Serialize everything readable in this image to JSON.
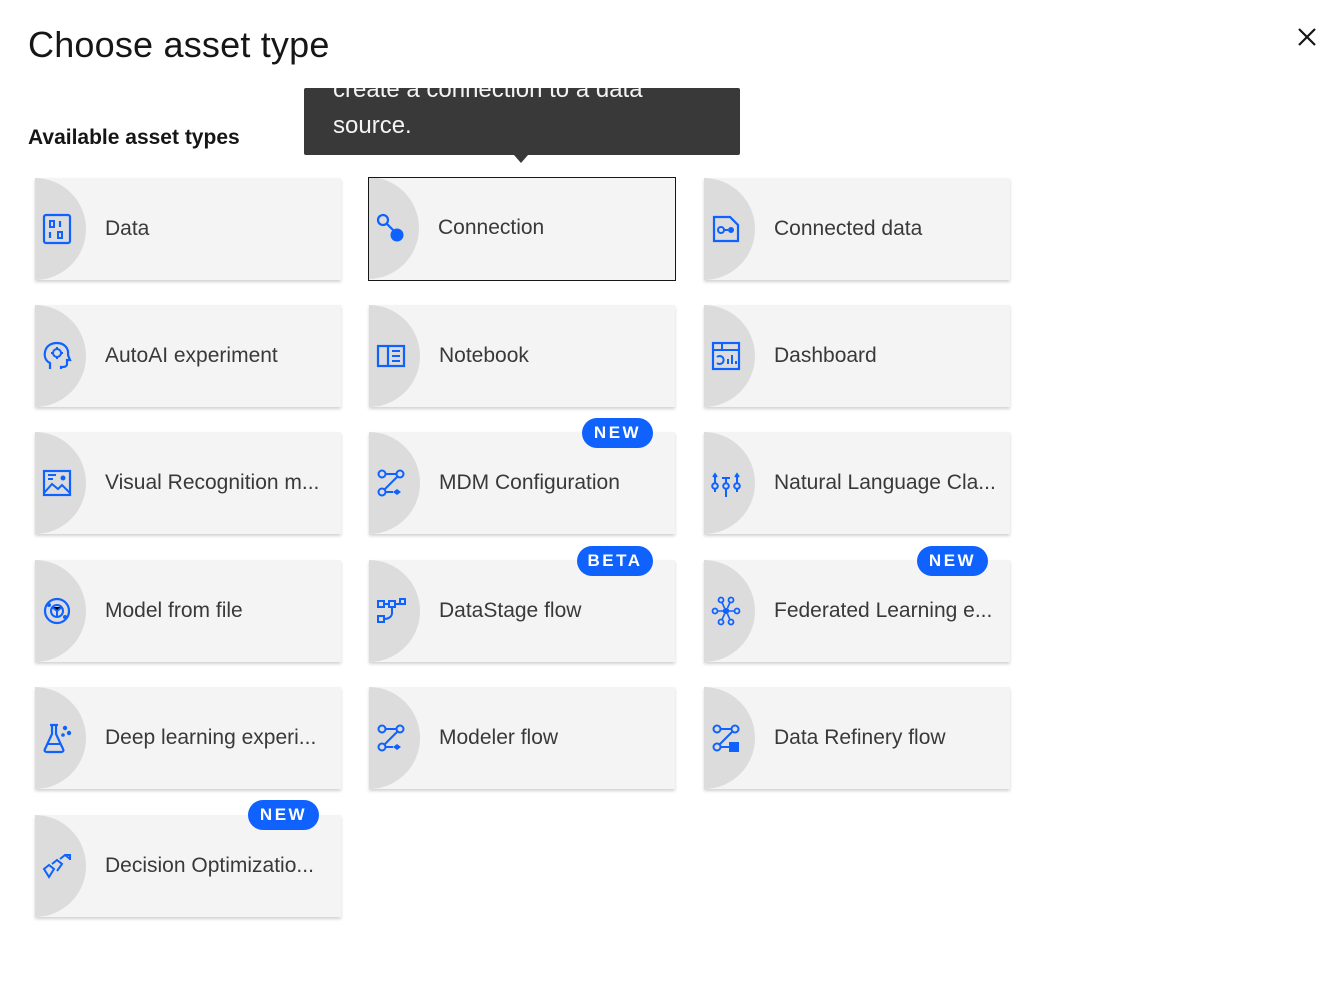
{
  "dialog": {
    "title": "Choose asset type",
    "close_icon": "close-icon"
  },
  "section": {
    "label": "Available asset types"
  },
  "tooltip": {
    "text": "create a connection to a data source."
  },
  "colors": {
    "accent": "#0f62fe",
    "tile_bg": "#f4f4f4",
    "tile_half_circle": "#dcdcdc",
    "tooltip_bg": "#393939"
  },
  "tiles": [
    {
      "label": "Data",
      "icon": "data-icon"
    },
    {
      "label": "Connection",
      "icon": "connection-icon",
      "selected": true
    },
    {
      "label": "Connected data",
      "icon": "connected-data-icon"
    },
    {
      "label": "AutoAI experiment",
      "icon": "autoai-icon"
    },
    {
      "label": "Notebook",
      "icon": "notebook-icon"
    },
    {
      "label": "Dashboard",
      "icon": "dashboard-icon"
    },
    {
      "label": "Visual Recognition m...",
      "icon": "visual-recognition-icon"
    },
    {
      "label": "MDM Configuration",
      "icon": "flow-icon",
      "badge": "NEW"
    },
    {
      "label": "Natural Language Cla...",
      "icon": "natural-language-icon"
    },
    {
      "label": "Model from file",
      "icon": "model-icon"
    },
    {
      "label": "DataStage flow",
      "icon": "datastage-icon",
      "badge": "BETA"
    },
    {
      "label": "Federated Learning e...",
      "icon": "federated-icon",
      "badge": "NEW"
    },
    {
      "label": "Deep learning experi...",
      "icon": "flask-icon"
    },
    {
      "label": "Modeler flow",
      "icon": "flow-icon"
    },
    {
      "label": "Data Refinery flow",
      "icon": "data-refinery-icon"
    },
    {
      "label": "Decision Optimizatio...",
      "icon": "decision-optimization-icon",
      "badge": "NEW"
    }
  ]
}
